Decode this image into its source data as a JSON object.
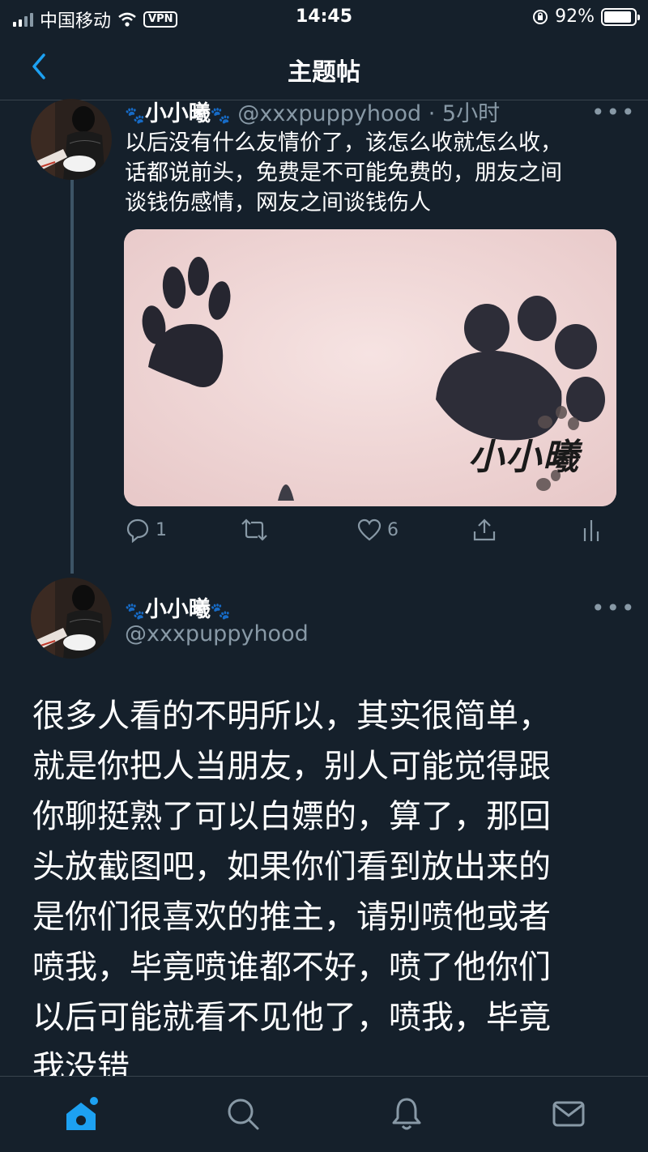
{
  "status": {
    "carrier": "中国移动",
    "vpn": "VPN",
    "time": "14:45",
    "battery": "92%",
    "battery_level": 0.92
  },
  "nav": {
    "title": "主题帖"
  },
  "tweet1": {
    "name": "小小曦",
    "handle": "@xxxpuppyhood",
    "separator": "·",
    "time": "5小时",
    "more": "•••",
    "text_lines": [
      "以后没有什么友情价了，该怎么收就怎么收，",
      "话都说前头，免费是不可能免费的，朋友之间",
      "谈钱伤感情，网友之间谈钱伤人"
    ],
    "watermark": "小小曦",
    "reply_count": "1",
    "like_count": "6"
  },
  "tweet2": {
    "name": "小小曦",
    "handle": "@xxxpuppyhood",
    "more": "•••",
    "text_lines": [
      "很多人看的不明所以，其实很简单，",
      "就是你把人当朋友，别人可能觉得跟",
      "你聊挺熟了可以白嫖的，算了，那回",
      "头放截图吧，如果你们看到放出来的",
      "是你们很喜欢的推主，请别喷他或者",
      "喷我，毕竟喷谁都不好，喷了他你们",
      "以后可能就看不见他了，喷我，毕竟",
      "我没错"
    ]
  },
  "icons": {
    "back": "chevron-left-icon",
    "reply": "reply-icon",
    "retweet": "retweet-icon",
    "like": "heart-icon",
    "share": "share-icon",
    "analytics": "analytics-icon",
    "home": "home-icon",
    "search": "search-icon",
    "notifications": "bell-icon",
    "messages": "mail-icon"
  },
  "colors": {
    "background": "#15202b",
    "accent": "#1da1f2",
    "secondary_text": "#8899a6",
    "divider": "#38444d"
  }
}
